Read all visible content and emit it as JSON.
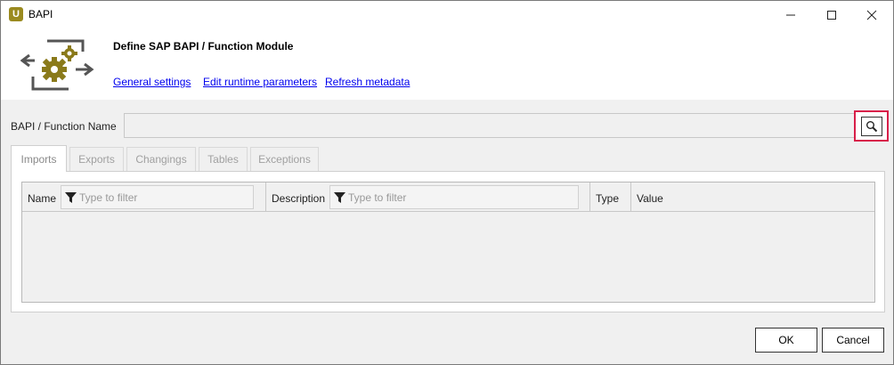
{
  "window": {
    "title": "BAPI",
    "app_icon_letter": "U",
    "icons": [
      "minimize-icon",
      "maximize-icon",
      "close-icon"
    ]
  },
  "header": {
    "title": "Define SAP BAPI / Function Module",
    "links": {
      "general": "General settings",
      "runtime": "Edit runtime parameters",
      "refresh": "Refresh metadata"
    },
    "logo_color": "#8a7a1a"
  },
  "form": {
    "function_label": "BAPI / Function Name",
    "function_value": ""
  },
  "tabs": [
    {
      "label": "Imports",
      "active": true
    },
    {
      "label": "Exports",
      "active": false
    },
    {
      "label": "Changings",
      "active": false
    },
    {
      "label": "Tables",
      "active": false
    },
    {
      "label": "Exceptions",
      "active": false
    }
  ],
  "grid": {
    "columns": {
      "name": "Name",
      "description": "Description",
      "type": "Type",
      "value": "Value"
    },
    "filter_placeholder": "Type to filter",
    "rows": []
  },
  "footer": {
    "ok": "OK",
    "cancel": "Cancel"
  },
  "colors": {
    "highlight": "#d81f49",
    "link": "#0000ee"
  }
}
